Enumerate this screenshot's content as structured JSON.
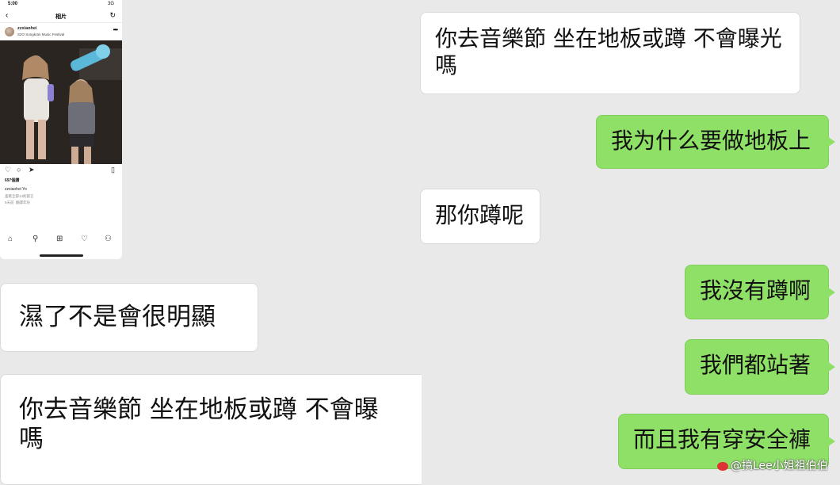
{
  "phone": {
    "status_time": "5:00",
    "status_signal": "3G",
    "nav_back": "‹",
    "nav_title": "相片",
    "nav_refresh": "↻",
    "post_username": "zzxiaohei",
    "post_location": "S2O Songkran Music Festival",
    "post_more": "•••",
    "likes": "697個讚",
    "caption": "zzxiaohei Yo",
    "comments_line": "查看全部14則留言",
    "time_line": "5天前",
    "translate_label": "翻譯年份"
  },
  "chat": {
    "messages": [
      {
        "side": "left",
        "text": "你去音樂節 坐在地板或蹲 不會曝光嗎"
      },
      {
        "side": "right",
        "text": "我为什么要做地板上"
      },
      {
        "side": "left",
        "text": "那你蹲呢"
      },
      {
        "side": "right",
        "text": "我沒有蹲啊"
      },
      {
        "side": "right",
        "text": "我們都站著"
      },
      {
        "side": "right",
        "text": "而且我有穿安全褲"
      }
    ],
    "quotes": [
      {
        "text": "濕了不是會很明顯"
      },
      {
        "text": "你去音樂節 坐在地板或蹲 不會曝\n嗎"
      }
    ]
  },
  "watermark": "@搞Lee小姐祖伯伯",
  "colors": {
    "background": "#e9e9e9",
    "outgoing_bubble": "#8fe067",
    "incoming_bubble": "#ffffff"
  }
}
